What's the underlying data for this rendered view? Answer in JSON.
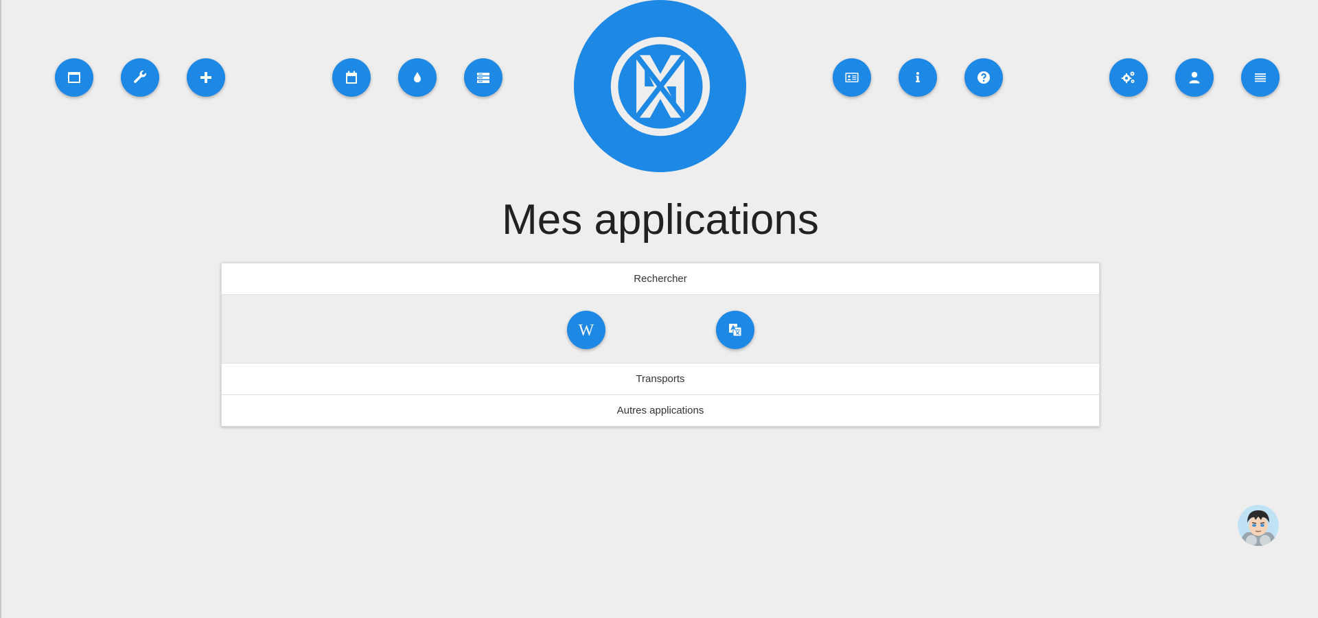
{
  "page": {
    "title": "Mes applications"
  },
  "theme": {
    "accent": "#1e88e5",
    "background": "#eeeeee"
  },
  "toolbar": {
    "left_group": [
      {
        "icon": "window-icon"
      },
      {
        "icon": "wrench-icon"
      },
      {
        "icon": "plus-icon"
      }
    ],
    "middle_left_group": [
      {
        "icon": "calendar-icon"
      },
      {
        "icon": "drop-icon"
      },
      {
        "icon": "storage-list-icon"
      }
    ],
    "middle_right_group": [
      {
        "icon": "id-card-icon"
      },
      {
        "icon": "info-icon"
      },
      {
        "icon": "question-icon"
      }
    ],
    "right_group": [
      {
        "icon": "gears-icon"
      },
      {
        "icon": "user-icon"
      },
      {
        "icon": "menu-icon"
      }
    ]
  },
  "logo": {
    "icon": "app-logo-icon"
  },
  "accordion": {
    "sections": [
      {
        "label": "Rechercher",
        "expanded": true,
        "apps": [
          {
            "icon": "wikipedia-icon",
            "glyph": "W"
          },
          {
            "icon": "translate-icon"
          }
        ]
      },
      {
        "label": "Transports",
        "expanded": false
      },
      {
        "label": "Autres applications",
        "expanded": false
      }
    ]
  },
  "avatar": {
    "icon": "user-avatar"
  }
}
